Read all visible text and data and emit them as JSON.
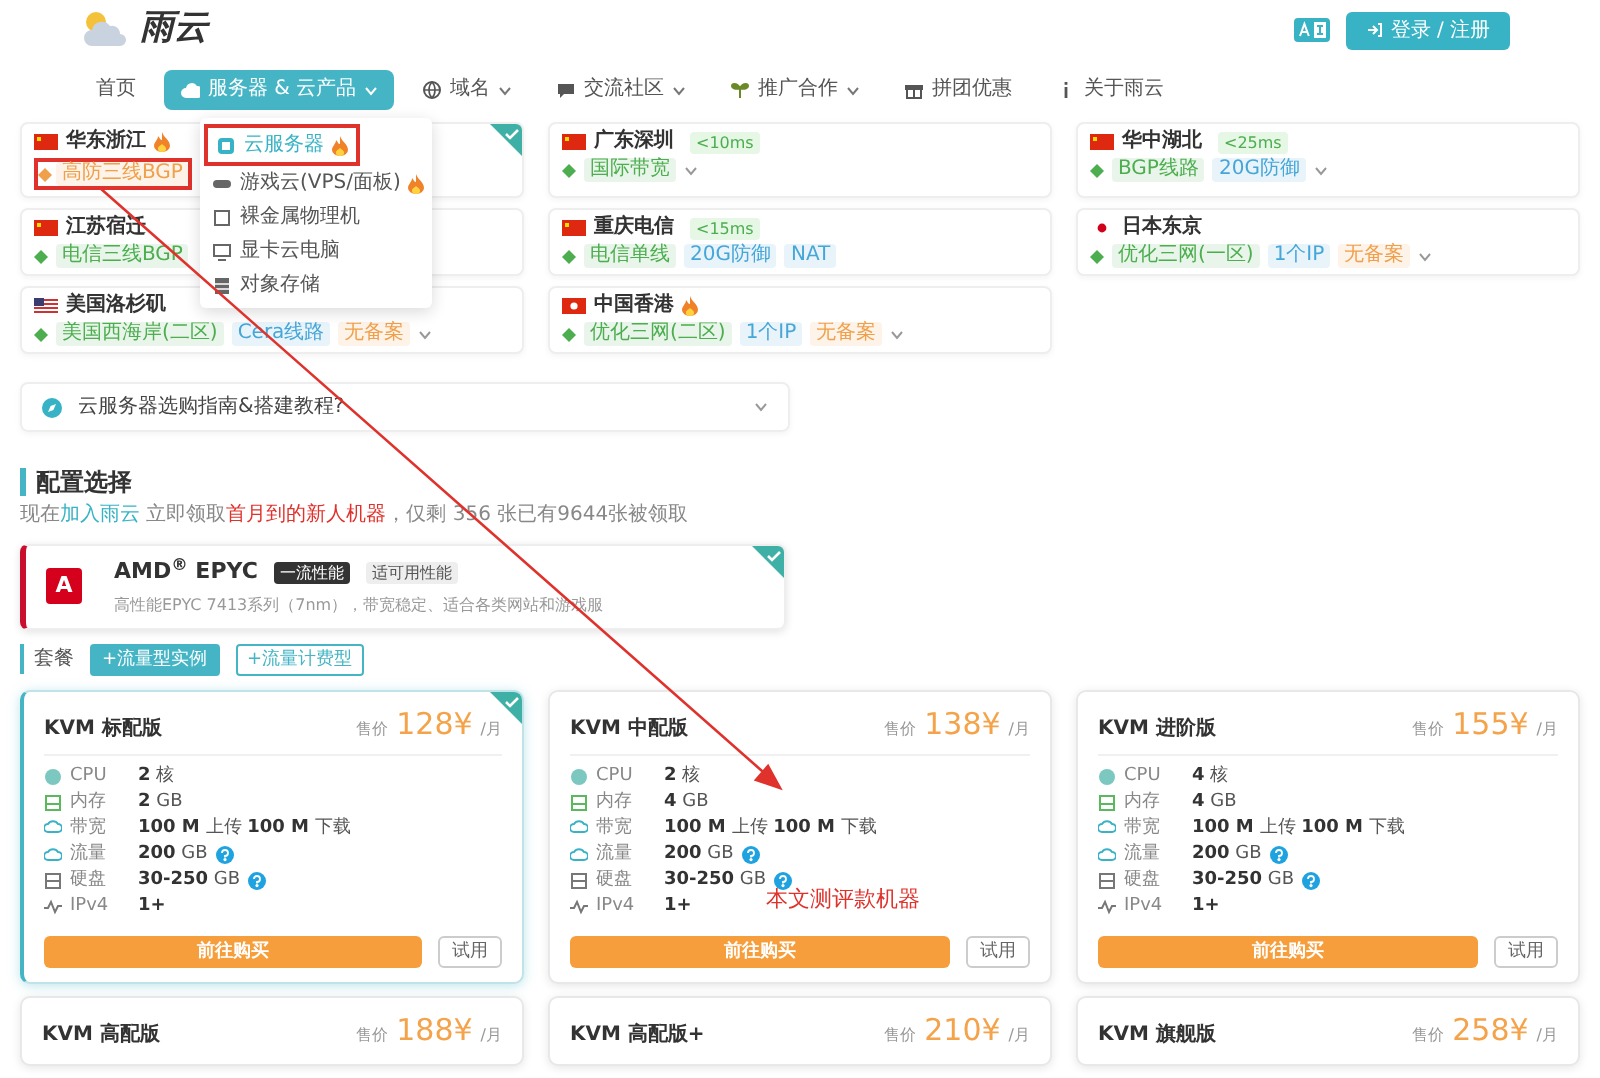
{
  "header": {
    "logo": "雨云",
    "login": "登录 / 注册"
  },
  "nav": [
    {
      "label": "首页",
      "dropdown": false,
      "selected": false
    },
    {
      "label": "服务器 & 云产品",
      "dropdown": true,
      "selected": true
    },
    {
      "label": "域名",
      "dropdown": true,
      "selected": false
    },
    {
      "label": "交流社区",
      "dropdown": true,
      "selected": false
    },
    {
      "label": "推广合作",
      "dropdown": true,
      "selected": false
    },
    {
      "label": "拼团优惠",
      "dropdown": false,
      "selected": false
    },
    {
      "label": "关于雨云",
      "dropdown": false,
      "selected": false
    }
  ],
  "menu": [
    {
      "label": "云服务器",
      "hot": true,
      "selected": true,
      "annotated": true
    },
    {
      "label": "游戏云(VPS/面板)",
      "hot": true,
      "selected": false,
      "annotated": false
    },
    {
      "label": "裸金属物理机",
      "hot": false,
      "selected": false,
      "annotated": false
    },
    {
      "label": "显卡云电脑",
      "hot": false,
      "selected": false,
      "annotated": false
    },
    {
      "label": "对象存储",
      "hot": false,
      "selected": false,
      "annotated": false
    }
  ],
  "regions": [
    {
      "name": "华东浙江",
      "hot": true,
      "selected": true,
      "expandable": false,
      "tags": [
        {
          "text": "高防三线BGP",
          "color": "#f0a04b",
          "annotated": true
        }
      ]
    },
    {
      "name": "广东深圳",
      "hot": false,
      "selected": false,
      "latency": "<10ms",
      "expandable": true,
      "tags": [
        {
          "text": "国际带宽",
          "color": "#4cae4f",
          "annotated": false
        }
      ]
    },
    {
      "name": "华中湖北",
      "hot": false,
      "selected": false,
      "latency": "<25ms",
      "expandable": true,
      "tags": [
        {
          "text": "BGP线路",
          "color": "#4cae4f",
          "annotated": false
        },
        {
          "text": "20G防御",
          "color": "#46a6d8",
          "annotated": false
        }
      ]
    },
    {
      "name": "江苏宿迁",
      "hot": false,
      "selected": false,
      "expandable": false,
      "tags": [
        {
          "text": "电信三线BGP",
          "color": "#4cae4f",
          "annotated": false
        }
      ]
    },
    {
      "name": "重庆电信",
      "hot": false,
      "selected": false,
      "latency": "<15ms",
      "expandable": false,
      "tags": [
        {
          "text": "电信单线",
          "color": "#4cae4f",
          "annotated": false
        },
        {
          "text": "20G防御",
          "color": "#46a6d8",
          "annotated": false
        },
        {
          "text": "NAT",
          "color": "#46a6d8",
          "annotated": false
        }
      ]
    },
    {
      "name": "日本东京",
      "hot": false,
      "selected": false,
      "expandable": true,
      "tags": [
        {
          "text": "优化三网(一区)",
          "color": "#4cae4f",
          "annotated": false
        },
        {
          "text": "1个IP",
          "color": "#46a6d8",
          "annotated": false
        },
        {
          "text": "无备案",
          "color": "#f0a04b",
          "annotated": false
        }
      ]
    },
    {
      "name": "美国洛杉矶",
      "hot": false,
      "selected": false,
      "expandable": true,
      "tags": [
        {
          "text": "美国西海岸(二区)",
          "color": "#4cae4f",
          "annotated": false
        },
        {
          "text": "Cera线路",
          "color": "#46a6d8",
          "annotated": false
        },
        {
          "text": "无备案",
          "color": "#f0a04b",
          "annotated": false
        }
      ]
    },
    {
      "name": "中国香港",
      "hot": true,
      "selected": false,
      "expandable": true,
      "tags": [
        {
          "text": "优化三网(二区)",
          "color": "#4cae4f",
          "annotated": false
        },
        {
          "text": "1个IP",
          "color": "#46a6d8",
          "annotated": false
        },
        {
          "text": "无备案",
          "color": "#f0a04b",
          "annotated": false
        }
      ]
    }
  ],
  "faq": {
    "text": "云服务器选购指南&搭建教程?"
  },
  "config": {
    "title": "配置选择",
    "intro": [
      {
        "kind": "plain",
        "text": "现在"
      },
      {
        "kind": "link",
        "text": "加入雨云"
      },
      {
        "kind": "plain",
        "text": " 立即领取"
      },
      {
        "kind": "highlight",
        "text": "首月到的新人机器"
      },
      {
        "kind": "plain",
        "text": "，仅剩 356 张已有9644张被领取"
      }
    ]
  },
  "cpu": {
    "badge": "A",
    "name": "AMD$^{®}$ EPYC",
    "tags": [
      {
        "text": "一流性能",
        "kind": "dark"
      },
      {
        "text": "适可用性能",
        "kind": "light"
      }
    ],
    "desc": "高性能EPYC 7413系列（7nm），带宽稳定、适合各类网站和游戏服",
    "selected": true
  },
  "package": {
    "label": "套餐",
    "options": [
      {
        "label": "+流量型实例",
        "selected": true
      },
      {
        "label": "+流量计费型",
        "selected": false
      }
    ]
  },
  "plans": [
    {
      "name": "KVM 标配版",
      "price_label": "售价",
      "price": "128¥",
      "per": "/月",
      "selected": true,
      "specs": [
        {
          "kind": "cpu",
          "label": "CPU",
          "value": "**2** 核",
          "help": false
        },
        {
          "kind": "memory",
          "label": "内存",
          "value": "**2** GB",
          "help": false
        },
        {
          "kind": "bandwidth",
          "label": "带宽",
          "value": "**100 M** 上传 **100 M** 下载",
          "help": false
        },
        {
          "kind": "traffic",
          "label": "流量",
          "value": "**200** GB",
          "help": true
        },
        {
          "kind": "disk",
          "label": "硬盘",
          "value": "**30-250** GB",
          "help": true
        },
        {
          "kind": "ip",
          "label": "IPv4",
          "value": "**1+**",
          "help": false
        }
      ],
      "buy": "前往购买",
      "trial": "试用"
    },
    {
      "name": "KVM 中配版",
      "price_label": "售价",
      "price": "138¥",
      "per": "/月",
      "selected": false,
      "note": "本文测评款机器",
      "specs": [
        {
          "kind": "cpu",
          "label": "CPU",
          "value": "**2** 核",
          "help": false
        },
        {
          "kind": "memory",
          "label": "内存",
          "value": "**4** GB",
          "help": false
        },
        {
          "kind": "bandwidth",
          "label": "带宽",
          "value": "**100 M** 上传 **100 M** 下载",
          "help": false
        },
        {
          "kind": "traffic",
          "label": "流量",
          "value": "**200** GB",
          "help": true
        },
        {
          "kind": "disk",
          "label": "硬盘",
          "value": "**30-250** GB",
          "help": true
        },
        {
          "kind": "ip",
          "label": "IPv4",
          "value": "**1+**",
          "help": false
        }
      ],
      "buy": "前往购买",
      "trial": "试用"
    },
    {
      "name": "KVM 进阶版",
      "price_label": "售价",
      "price": "155¥",
      "per": "/月",
      "selected": false,
      "specs": [
        {
          "kind": "cpu",
          "label": "CPU",
          "value": "**4** 核",
          "help": false
        },
        {
          "kind": "memory",
          "label": "内存",
          "value": "**4** GB",
          "help": false
        },
        {
          "kind": "bandwidth",
          "label": "带宽",
          "value": "**100 M** 上传 **100 M** 下载",
          "help": false
        },
        {
          "kind": "traffic",
          "label": "流量",
          "value": "**200** GB",
          "help": true
        },
        {
          "kind": "disk",
          "label": "硬盘",
          "value": "**30-250** GB",
          "help": true
        },
        {
          "kind": "ip",
          "label": "IPv4",
          "value": "**1+**",
          "help": false
        }
      ],
      "buy": "前往购买",
      "trial": "试用"
    },
    {
      "name": "KVM 高配版",
      "price_label": "售价",
      "price": "188¥",
      "per": "/月",
      "selected": false
    },
    {
      "name": "KVM 高配版+",
      "price_label": "售价",
      "price": "210¥",
      "per": "/月",
      "selected": false
    },
    {
      "name": "KVM 旗舰版",
      "price_label": "售价",
      "price": "258¥",
      "per": "/月",
      "selected": false
    }
  ]
}
